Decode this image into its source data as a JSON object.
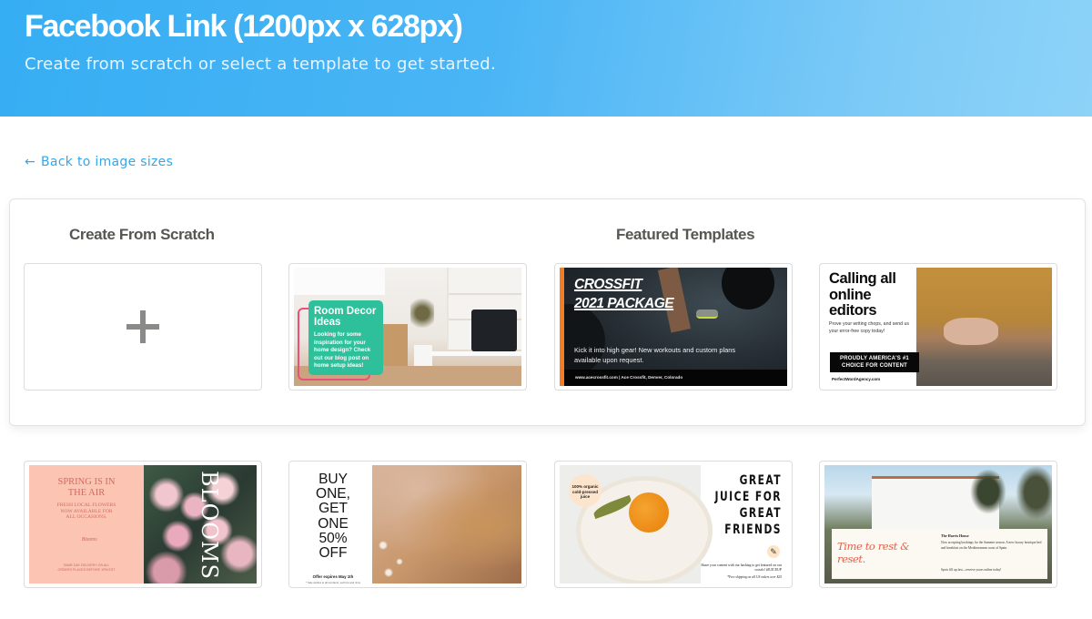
{
  "header": {
    "title": "Facebook Link (1200px x 628px)",
    "subtitle": "Create from scratch or select a template to get started."
  },
  "nav": {
    "back_icon": "arrow-left-icon",
    "back_arrow": "←",
    "back_label": "Back to image sizes"
  },
  "sections": {
    "scratch_title": "Create From Scratch",
    "featured_title": "Featured Templates"
  },
  "scratch_card": {
    "icon": "plus-icon"
  },
  "templates": [
    {
      "name": "room-decor",
      "heading": "Room Decor Ideas",
      "body": "Looking for some inspiration for your home design? Check out our blog post on home setup ideas!"
    },
    {
      "name": "crossfit",
      "heading_line1": "CROSSFIT",
      "heading_line2": "2021 PACKAGE",
      "body": "Kick it into high gear! New workouts and custom plans available upon request.",
      "footer": "www.acecrossfit.com  |  Ace Crossfit, Denver, Colorado"
    },
    {
      "name": "calling-editors",
      "heading": "Calling all online editors",
      "body": "Prove your writing chops, and send us your error-free copy today!",
      "badge": "PROUDLY AMERICA'S #1 CHOICE FOR CONTENT",
      "url": "PerfectWordAgency.com"
    },
    {
      "name": "spring-blooms",
      "heading": "SPRING IS IN THE AIR",
      "body": "FRESH LOCAL FLOWERS NOW AVAILABLE FOR ALL OCCASIONS.",
      "signature": "Blooms",
      "footer": "SAME DAY DELIVERY ON ALL ORDERS PLACED BEFORE 1PM EST",
      "side_word": "BLOOMS"
    },
    {
      "name": "buy-one-get-one",
      "heading": "BUY ONE, GET ONE 50% OFF",
      "offer": "Offer expires May 1th",
      "fine_print": "* Sale applies to all pendants, earrings and rings"
    },
    {
      "name": "great-juice",
      "sticker": "100% organic cold-pressed juice",
      "heading": "GREAT JUICE FOR GREAT FRIENDS",
      "body": "Share your content with our hashtag to get featured on our socials! #JUICEUP",
      "fine_print": "*Free shipping on all US orders over $25",
      "icon": "carrot-icon"
    },
    {
      "name": "time-to-rest",
      "heading": "Time to rest & reset.",
      "title": "The Harris House",
      "body": "Now accepting bookings for the Summer season. A new luxury boutique bed and breakfast on the Mediterranean coast of Spain.",
      "cta": "Spots fill up fast—reserve yours online today!"
    }
  ]
}
